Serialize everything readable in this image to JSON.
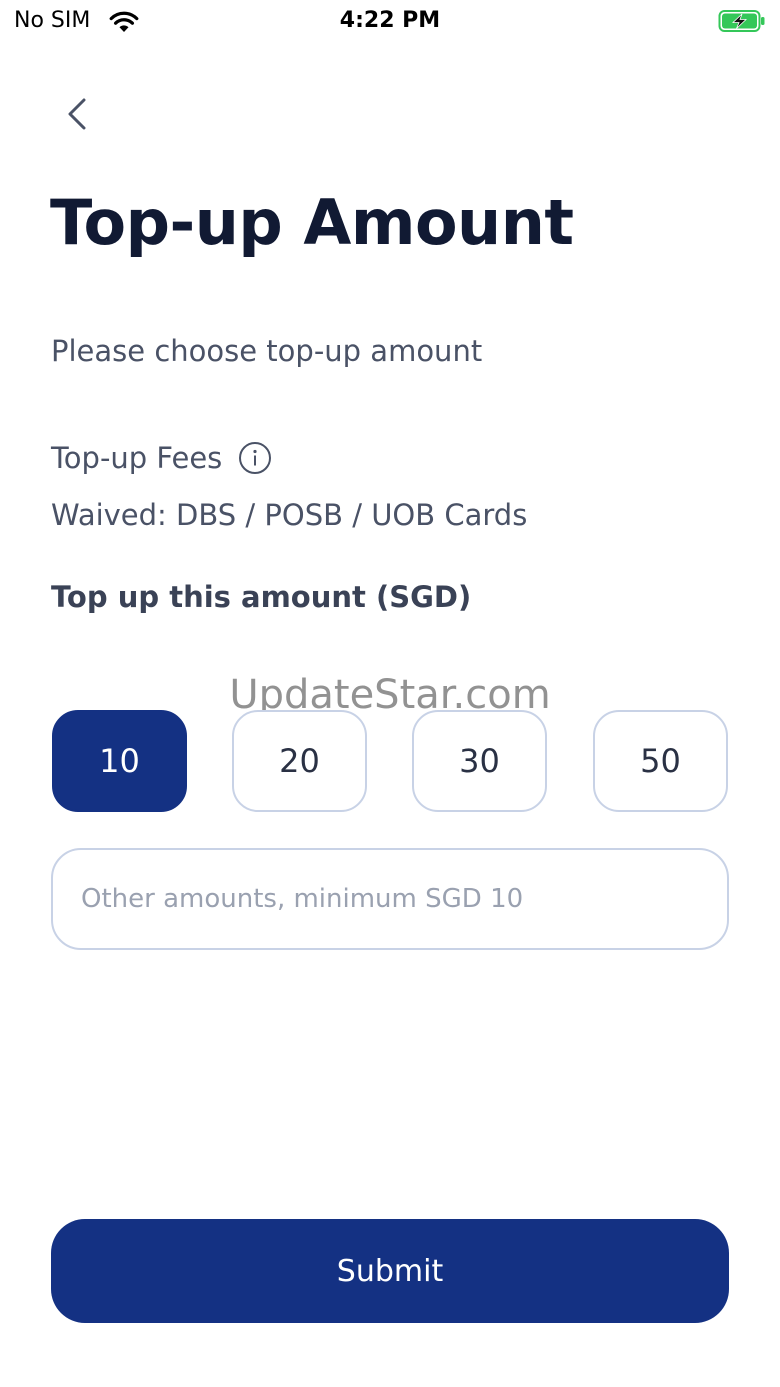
{
  "status_bar": {
    "carrier": "No SIM",
    "time": "4:22 PM",
    "wifi_icon": "wifi-icon",
    "battery_icon": "battery-charging-icon",
    "battery_color": "#34c759"
  },
  "header": {
    "back_icon": "chevron-left-icon",
    "title": "Top-up Amount"
  },
  "content": {
    "subtitle": "Please choose top-up amount",
    "fees_label": "Top-up Fees",
    "fees_info_icon": "info-icon",
    "waived_text": "Waived: DBS / POSB / UOB Cards",
    "amount_label": "Top up this amount (SGD)"
  },
  "amounts": {
    "options": [
      "10",
      "20",
      "30",
      "50"
    ],
    "selected": "10"
  },
  "other_amount": {
    "value": "",
    "placeholder": "Other amounts, minimum SGD 10"
  },
  "watermark": "UpdateStar.com",
  "submit": {
    "label": "Submit"
  },
  "colors": {
    "primary": "#143183",
    "title": "#111a33",
    "body_text": "#4a5266",
    "border": "#c8d2e6"
  }
}
